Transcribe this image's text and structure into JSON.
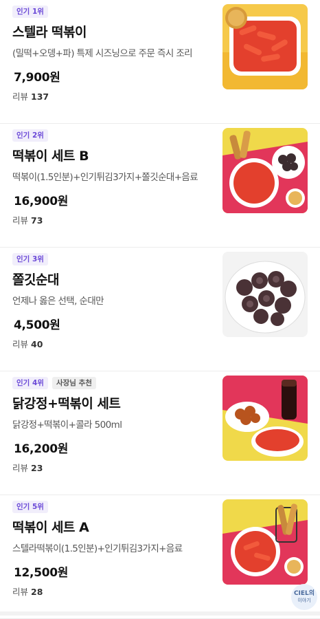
{
  "menu_items": [
    {
      "rank_badge": "인기 1위",
      "extra_badge": "",
      "name": "스텔라 떡볶이",
      "description": "(밀떡+오뎅+파) 특제 시즈닝으로 주문 즉시 조리",
      "price": "7,900원",
      "review_label": "리뷰",
      "review_count": "137"
    },
    {
      "rank_badge": "인기 2위",
      "extra_badge": "",
      "name": "떡볶이 세트 B",
      "description": "떡볶이(1.5인분)+인기튀김3가지+쫄깃순대+음료",
      "price": "16,900원",
      "review_label": "리뷰",
      "review_count": "73"
    },
    {
      "rank_badge": "인기 3위",
      "extra_badge": "",
      "name": "쫄깃순대",
      "description": "언제나 옳은 선택, 순대만",
      "price": "4,500원",
      "review_label": "리뷰",
      "review_count": "40"
    },
    {
      "rank_badge": "인기 4위",
      "extra_badge": "사장님 추천",
      "name": "닭강정+떡볶이 세트",
      "description": "닭강정+떡볶이+콜라 500ml",
      "price": "16,200원",
      "review_label": "리뷰",
      "review_count": "23"
    },
    {
      "rank_badge": "인기 5위",
      "extra_badge": "",
      "name": "떡볶이 세트 A",
      "description": "스텔라떡볶이(1.5인분)+인기튀김3가지+음료",
      "price": "12,500원",
      "review_label": "리뷰",
      "review_count": "28"
    }
  ],
  "watermark": {
    "line1": "CIEL의",
    "line2": "이야기"
  },
  "colors": {
    "badge_purple": "#6a48d7",
    "badge_bg": "#f1eefb"
  }
}
